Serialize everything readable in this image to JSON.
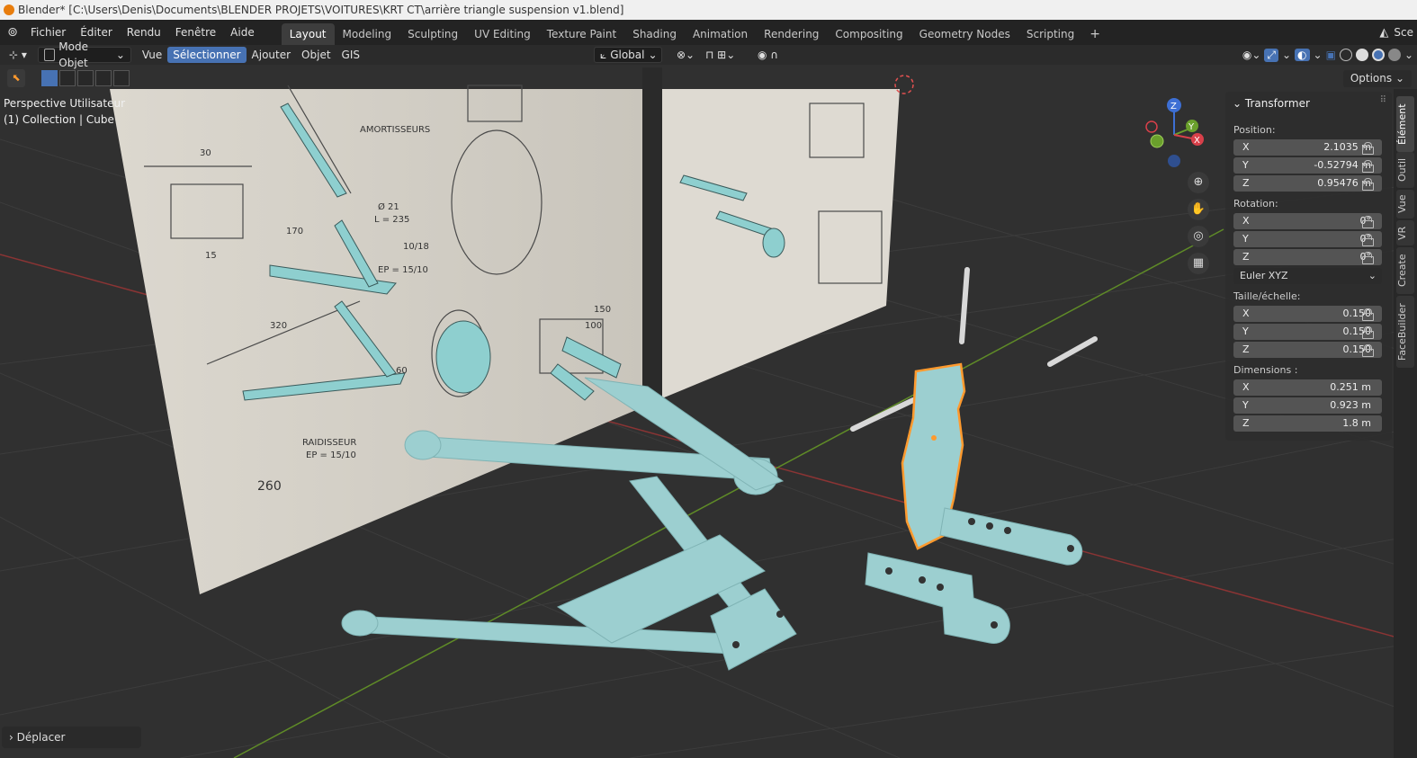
{
  "window": {
    "title": "Blender* [C:\\Users\\Denis\\Documents\\BLENDER PROJETS\\VOITURES\\KRT CT\\arrière triangle suspension v1.blend]"
  },
  "menu": {
    "items": [
      "Fichier",
      "Éditer",
      "Rendu",
      "Fenêtre",
      "Aide"
    ]
  },
  "workspaces": {
    "tabs": [
      "Layout",
      "Modeling",
      "Sculpting",
      "UV Editing",
      "Texture Paint",
      "Shading",
      "Animation",
      "Rendering",
      "Compositing",
      "Geometry Nodes",
      "Scripting"
    ],
    "add": "+",
    "scene_cut": "Sce"
  },
  "header": {
    "mode": "Mode Objet",
    "menus": [
      "Vue",
      "Sélectionner",
      "Ajouter",
      "Objet",
      "GIS"
    ],
    "transform_orientation": "Global",
    "options_label": "Options"
  },
  "viewport": {
    "view_label": "Perspective Utilisateur",
    "collection_label": "(1) Collection | Cube",
    "gizmo_axes": {
      "x": "X",
      "y": "Y",
      "z": "Z"
    }
  },
  "transform_panel": {
    "title": "Transformer",
    "position_label": "Position:",
    "position": [
      {
        "axis": "X",
        "value": "2.1035 m"
      },
      {
        "axis": "Y",
        "value": "-0.52794 m"
      },
      {
        "axis": "Z",
        "value": "0.95476 m"
      }
    ],
    "rotation_label": "Rotation:",
    "rotation": [
      {
        "axis": "X",
        "value": "0°"
      },
      {
        "axis": "Y",
        "value": "0°"
      },
      {
        "axis": "Z",
        "value": "0°"
      }
    ],
    "rotation_mode": "Euler XYZ",
    "scale_label": "Taille/échelle:",
    "scale": [
      {
        "axis": "X",
        "value": "0.150"
      },
      {
        "axis": "Y",
        "value": "0.150"
      },
      {
        "axis": "Z",
        "value": "0.150"
      }
    ],
    "dimensions_label": "Dimensions  :",
    "dimensions": [
      {
        "axis": "X",
        "value": "0.251 m"
      },
      {
        "axis": "Y",
        "value": "0.923 m"
      },
      {
        "axis": "Z",
        "value": "1.8 m"
      }
    ]
  },
  "side_tabs": [
    "Élément",
    "Outil",
    "Vue",
    "VR",
    "Create",
    "FaceBuilder"
  ],
  "last_operation": "Déplacer",
  "drawing_labels": [
    "AMORTISSEURS",
    "30",
    "15",
    "170",
    "Ø 21",
    "L = 235",
    "EP = 15/10",
    "10/18",
    "320",
    "60",
    "RAIDISSEUR",
    "EP = 15/10",
    "260",
    "150",
    "100"
  ],
  "colors": {
    "accent": "#4772b3",
    "selected_outline": "#ff9a2e",
    "part": "#93c5c7",
    "grid_x": "#9a3a3a",
    "grid_y": "#6a8a2a"
  }
}
